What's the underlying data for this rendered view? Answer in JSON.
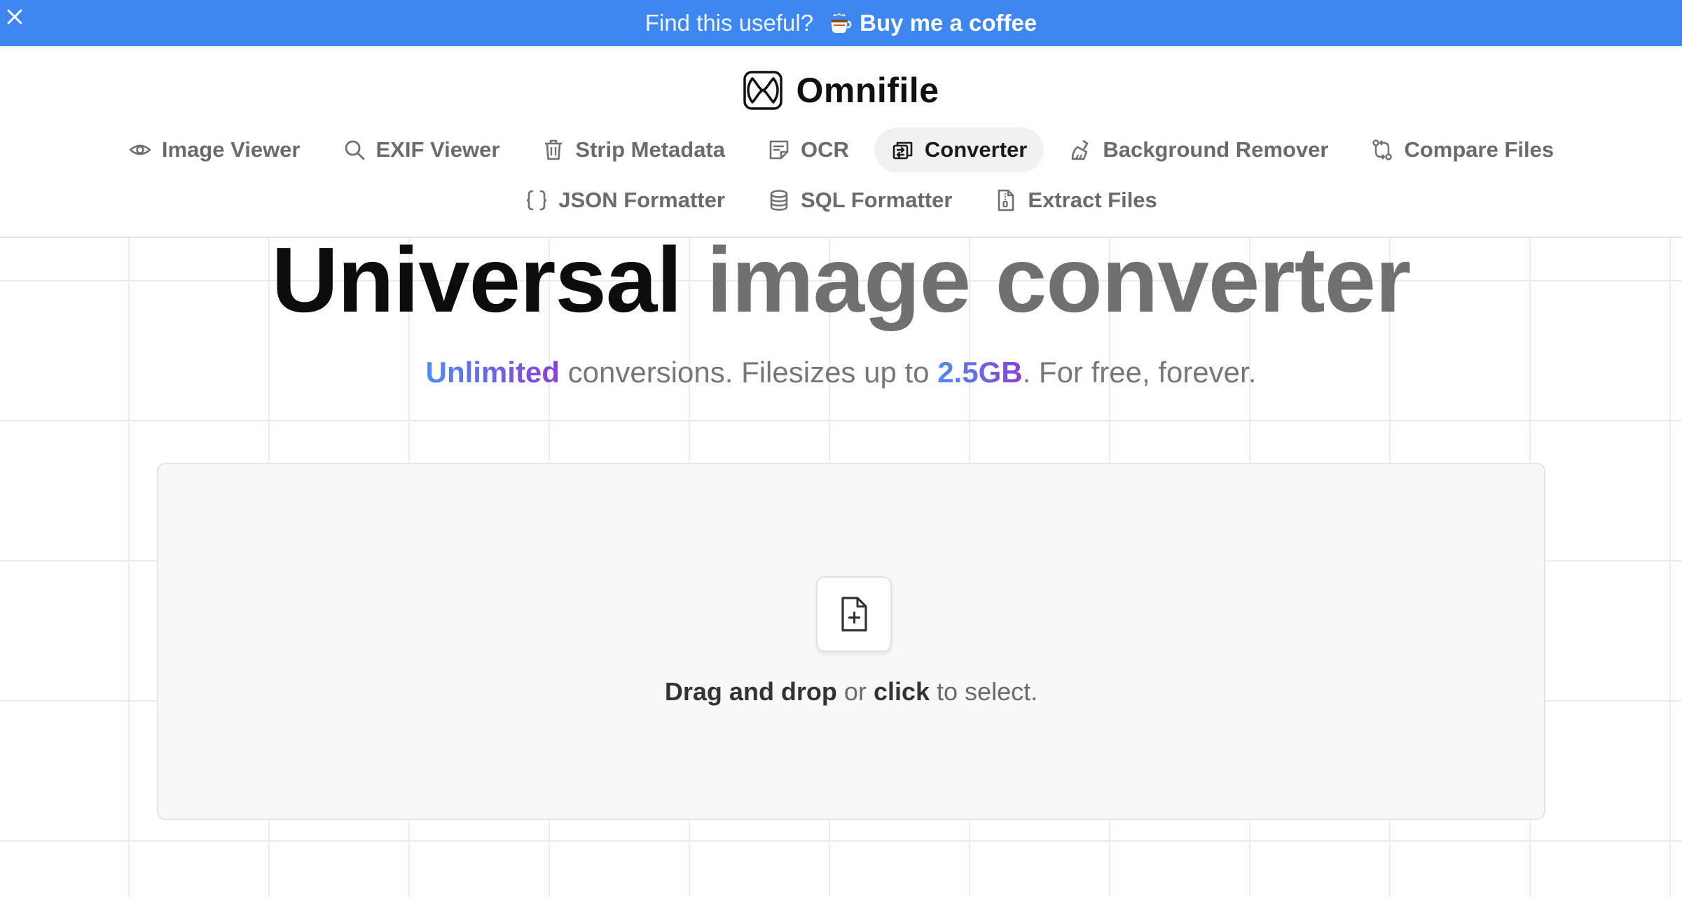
{
  "banner": {
    "text": "Find this useful?",
    "link_label": "Buy me a coffee",
    "close_icon": "close-icon",
    "coffee_icon": "coffee-cup-icon",
    "background_color": "#3e86f0"
  },
  "brand": {
    "name": "Omnifile",
    "logo_icon": "omnifile-logo-icon"
  },
  "nav": {
    "row1": [
      {
        "label": "Image Viewer",
        "icon": "eye-icon",
        "active": false
      },
      {
        "label": "EXIF Viewer",
        "icon": "search-icon",
        "active": false
      },
      {
        "label": "Strip Metadata",
        "icon": "trash-icon",
        "active": false
      },
      {
        "label": "OCR",
        "icon": "note-icon",
        "active": false
      },
      {
        "label": "Converter",
        "icon": "convert-icon",
        "active": true
      },
      {
        "label": "Background Remover",
        "icon": "brush-icon",
        "active": false
      },
      {
        "label": "Compare Files",
        "icon": "git-compare-icon",
        "active": false
      }
    ],
    "row2": [
      {
        "label": "JSON Formatter",
        "icon": "braces-icon",
        "active": false
      },
      {
        "label": "SQL Formatter",
        "icon": "database-icon",
        "active": false
      },
      {
        "label": "Extract Files",
        "icon": "file-zip-icon",
        "active": false
      }
    ]
  },
  "hero": {
    "title_dark": "Universal",
    "title_grey": "image converter",
    "subtitle_highlight1": "Unlimited",
    "subtitle_part1": " conversions. Filesizes up to ",
    "subtitle_highlight2": "2.5GB",
    "subtitle_part2": ". For free, forever."
  },
  "dropzone": {
    "icon": "file-plus-icon",
    "text_bold1": "Drag and drop",
    "text_mid": " or ",
    "text_bold2": "click",
    "text_end": " to select."
  }
}
